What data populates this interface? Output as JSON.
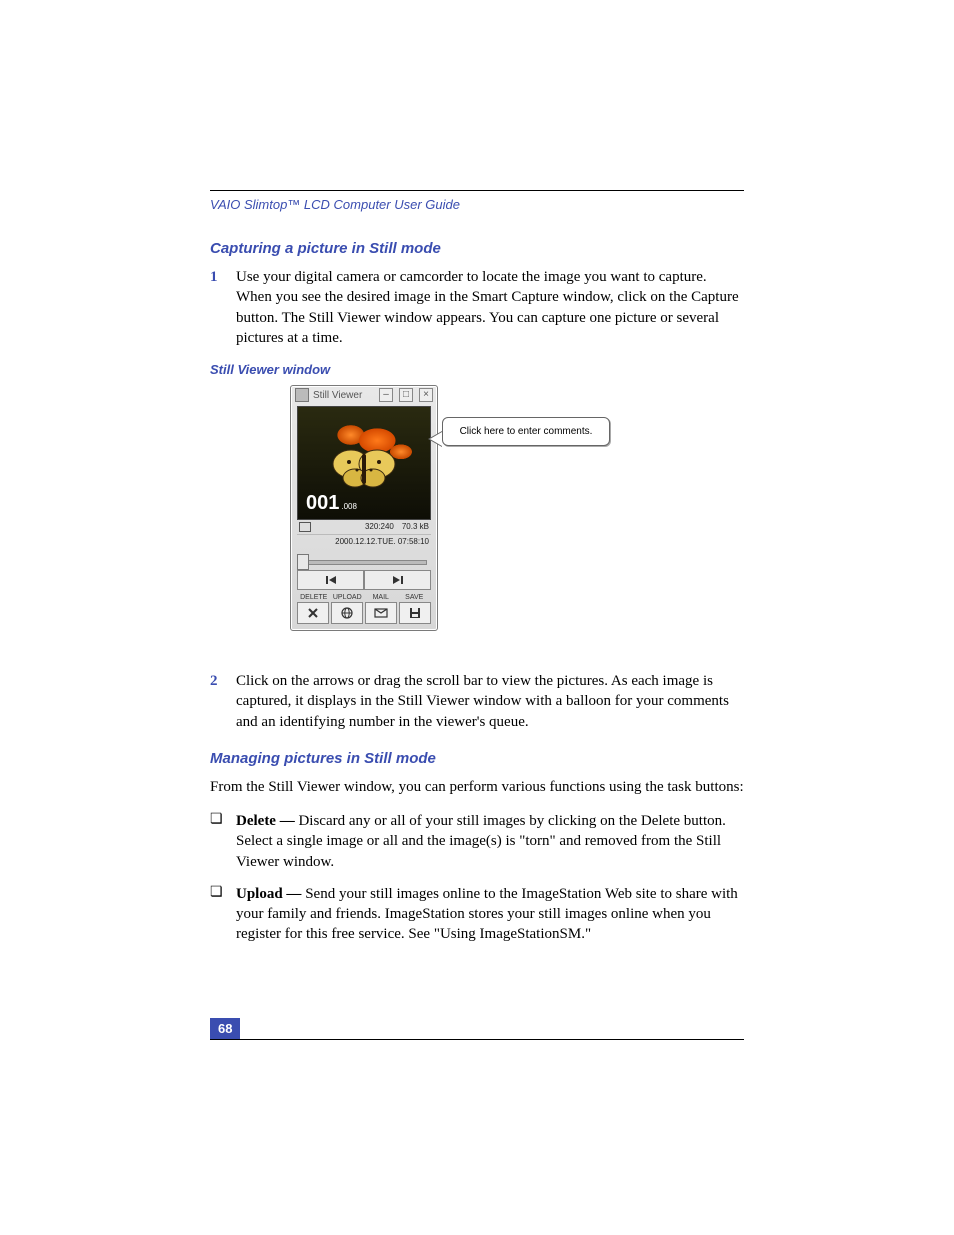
{
  "running_head": "VAIO Slimtop™ LCD Computer User Guide",
  "section1": {
    "title": "Capturing a picture in Still mode",
    "steps": [
      {
        "num": "1",
        "text": "Use your digital camera or camcorder to locate the image you want to capture. When you see the desired image in the Smart Capture window, click on the Capture button. The Still Viewer window appears. You can capture one picture or several pictures at a time."
      },
      {
        "num": "2",
        "text": "Click on the arrows or drag the scroll bar to view the pictures. As each image is captured, it displays in the Still Viewer window with a balloon for your comments and an identifying number in the viewer's queue."
      }
    ]
  },
  "figure": {
    "caption": "Still Viewer window",
    "window_title": "Still Viewer",
    "image_number": "001",
    "image_ext": ".008",
    "meta_resolution": "320:240",
    "meta_size": "70.3 kB",
    "meta_timestamp": "2000.12.12.TUE.  07:58:10",
    "actions": {
      "delete": "DELETE",
      "upload": "UPLOAD",
      "mail": "MAIL",
      "save": "SAVE"
    },
    "callout_text": "Click here to enter comments."
  },
  "section2": {
    "title": "Managing pictures in Still mode",
    "intro": "From the Still Viewer window, you can perform various functions using the task buttons:",
    "bullets": [
      {
        "term": "Delete — ",
        "text": "Discard any or all of your still images by clicking on the Delete button. Select a single image or all and the image(s) is \"torn\" and removed from the Still Viewer window."
      },
      {
        "term": "Upload — ",
        "text": "Send your still images online to the ImageStation Web site to share with your family and friends. ImageStation stores your still images online when you register for this free service. See \"Using ImageStationSM.\""
      }
    ]
  },
  "page_number": "68"
}
